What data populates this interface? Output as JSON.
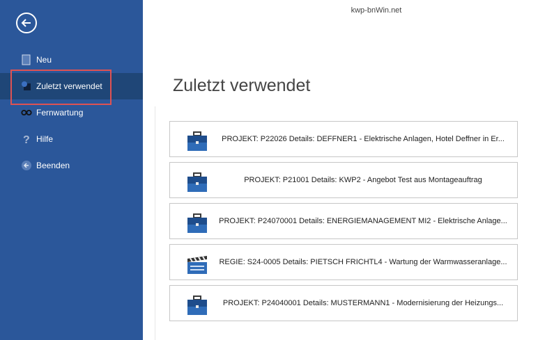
{
  "window": {
    "title": "kwp-bnWin.net"
  },
  "sidebar": {
    "back_icon": "back-arrow-icon",
    "items": [
      {
        "label": "Neu",
        "icon": "new-icon"
      },
      {
        "label": "Zuletzt verwendet",
        "icon": "recent-icon",
        "active": true
      },
      {
        "label": "Fernwartung",
        "icon": "remote-icon"
      },
      {
        "label": "Hilfe",
        "icon": "help-icon"
      },
      {
        "label": "Beenden",
        "icon": "exit-icon"
      }
    ]
  },
  "main": {
    "title": "Zuletzt verwendet",
    "recent": [
      {
        "icon": "briefcase-icon",
        "text": "PROJEKT: P22026 Details: DEFFNER1 - Elektrische Anlagen, Hotel Deffner in Er..."
      },
      {
        "icon": "briefcase-icon",
        "text": "PROJEKT: P21001 Details: KWP2 - Angebot Test aus Montageauftrag"
      },
      {
        "icon": "briefcase-icon",
        "text": "PROJEKT: P24070001 Details: ENERGIEMANAGEMENT MI2 - Elektrische Anlage..."
      },
      {
        "icon": "clapperboard-icon",
        "text": "REGIE: S24-0005 Details: PIETSCH FRICHTL4 - Wartung der Warmwasseranlage..."
      },
      {
        "icon": "briefcase-icon",
        "text": "PROJEKT: P24040001 Details: MUSTERMANN1 - Modernisierung der Heizungs..."
      }
    ]
  },
  "colors": {
    "sidebar": "#2b579a",
    "sidebar_active": "#1f4677",
    "highlight": "#e05252"
  }
}
